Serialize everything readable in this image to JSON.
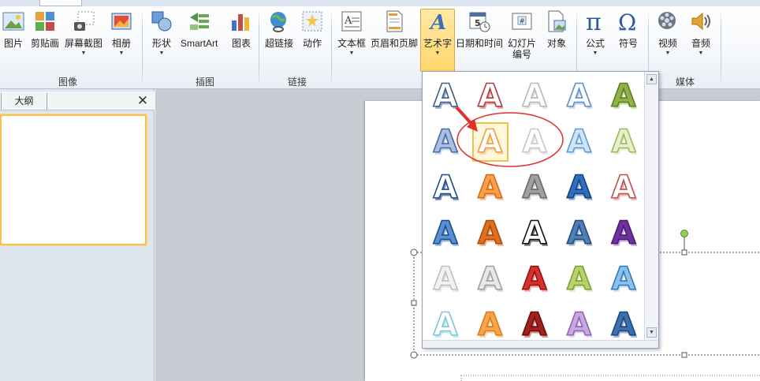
{
  "ribbon": {
    "buttons": {
      "picture": "图片",
      "clipart": "剪贴画",
      "screenshot": "屏幕截图",
      "album": "相册",
      "shapes": "形状",
      "smartart": "SmartArt",
      "chart": "图表",
      "hyperlink": "超链接",
      "action": "动作",
      "textbox": "文本框",
      "header_footer": "页眉和页脚",
      "wordart": "艺术字",
      "datetime": "日期和时间",
      "slide_number_1": "幻灯片",
      "slide_number_2": "编号",
      "object": "对象",
      "equation": "公式",
      "symbol": "符号",
      "video": "视频",
      "audio": "音频",
      "dropdown_glyph": "▼"
    },
    "groups": {
      "images": "图像",
      "illustrations": "插图",
      "links": "链接",
      "media": "媒体"
    }
  },
  "left_pane": {
    "outline_tab": "大纲",
    "close_glyph": "✕"
  },
  "wordart_gallery": {
    "glyph": "A",
    "scroll_up": "▲",
    "scroll_down": "▼",
    "selected_index": 6,
    "styles": [
      {
        "fill": "#ffffff",
        "stroke": "#3e5f8c",
        "shadow": "#9aaac0"
      },
      {
        "fill": "#ffffff",
        "stroke": "#b23a3a",
        "shadow": "#e5a0a0"
      },
      {
        "fill": "#ffffff",
        "stroke": "#b8b8b8",
        "shadow": "#e4e4e4"
      },
      {
        "fill": "#ffffff",
        "stroke": "#5e8fc4",
        "shadow": "#c2d4ea"
      },
      {
        "fill": "#8fb249",
        "stroke": "#5c7d23",
        "shadow": "#c8db9c"
      },
      {
        "fill": "#a8bfe2",
        "stroke": "#4a6aa8",
        "shadow": "#c8d6ee"
      },
      {
        "fill": "#ffffff",
        "stroke": "#f29a3b",
        "shadow": "#f8d2a4"
      },
      {
        "fill": "#ffffff",
        "stroke": "#c9c9c9",
        "shadow": "#e8e8e8"
      },
      {
        "fill": "#cfe4f6",
        "stroke": "#5b9bd5",
        "shadow": "#dbe9f6"
      },
      {
        "fill": "#e6f0cf",
        "stroke": "#9bbb59",
        "shadow": "#e6efd2"
      },
      {
        "fill": "#ffffff",
        "stroke": "#1f4e8a",
        "shadow": "#6c8bb4"
      },
      {
        "fill": "#f8a14d",
        "stroke": "#d86a12",
        "shadow": "#f4c39a"
      },
      {
        "fill": "#a0a0a0",
        "stroke": "#6a6a6a",
        "shadow": "#cfcfcf"
      },
      {
        "fill": "#2e6fbd",
        "stroke": "#18407a",
        "shadow": "#8eb0dc"
      },
      {
        "fill": "#ffffff",
        "stroke": "#c0504d",
        "shadow": "#ebb5b4"
      },
      {
        "fill": "#5a8fd0",
        "stroke": "#1d4f8f",
        "shadow": "#9ab8e0"
      },
      {
        "fill": "#e07020",
        "stroke": "#a54c10",
        "shadow": "#f0b27e"
      },
      {
        "fill": "#ffffff",
        "stroke": "#111111",
        "shadow": "#777777"
      },
      {
        "fill": "#4f7fb4",
        "stroke": "#24497a",
        "shadow": "#a8c0dc"
      },
      {
        "fill": "#7030a0",
        "stroke": "#4a1d6e",
        "shadow": "#c7a9dd"
      },
      {
        "fill": "#f2f2f2",
        "stroke": "#bfbfbf",
        "shadow": "#e4e4e4"
      },
      {
        "fill": "#e8e8e8",
        "stroke": "#a0a0a0",
        "shadow": "#d8d8d8"
      },
      {
        "fill": "#d9302c",
        "stroke": "#8e1512",
        "shadow": "#f0a5a3"
      },
      {
        "fill": "#b5d36e",
        "stroke": "#7f9f30",
        "shadow": "#dbe8bc"
      },
      {
        "fill": "#8ec1ea",
        "stroke": "#2f78c2",
        "shadow": "#c9e0f4"
      },
      {
        "fill": "#ffffff",
        "stroke": "#7ac7d6",
        "shadow": "#c5e8ef"
      },
      {
        "fill": "#f7a54a",
        "stroke": "#dd7a18",
        "shadow": "#f7d3a8"
      },
      {
        "fill": "#a3201c",
        "stroke": "#6a0f0d",
        "shadow": "#d68e8b"
      },
      {
        "fill": "#c7a9e0",
        "stroke": "#8e63b8",
        "shadow": "#e3d4f0"
      },
      {
        "fill": "#3d6fb0",
        "stroke": "#1f4478",
        "shadow": "#9cb6da"
      }
    ]
  }
}
